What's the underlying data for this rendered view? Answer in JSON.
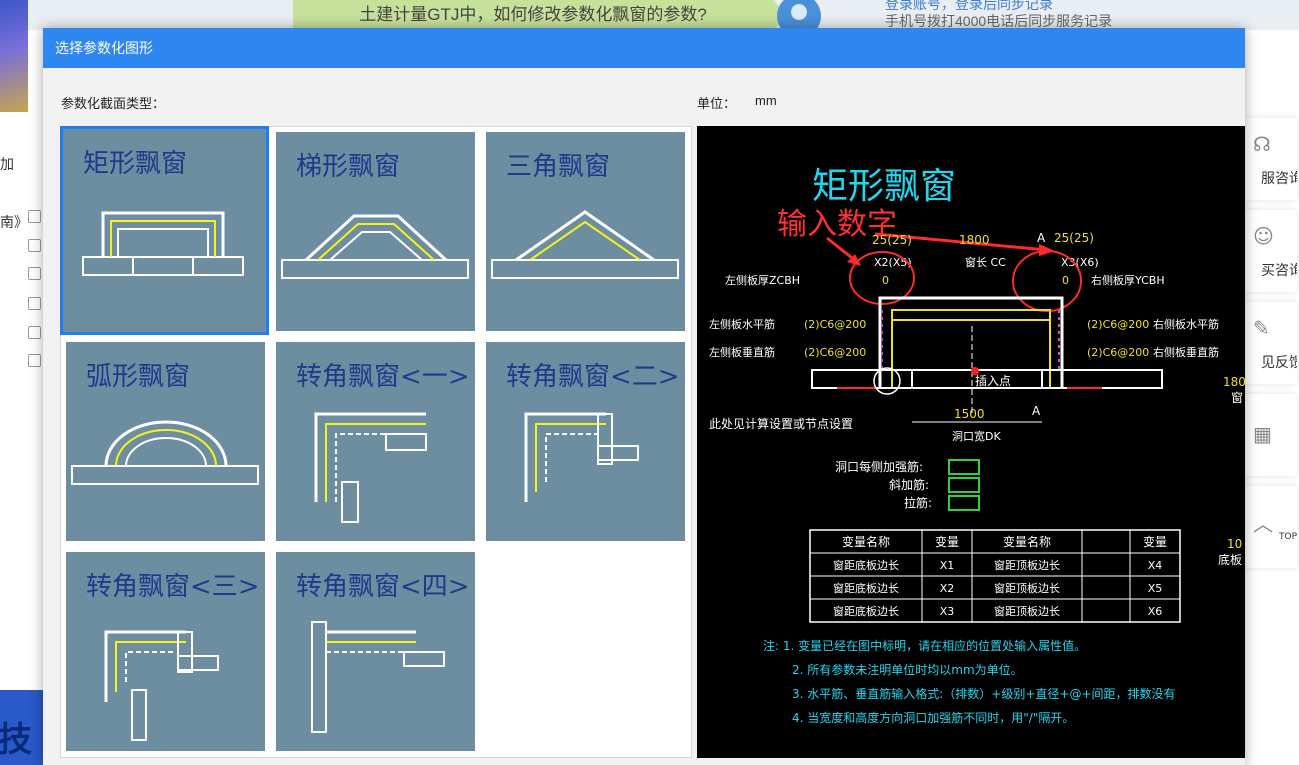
{
  "background_page": {
    "banner_question": "土建计量GTJ中，如何修改参数化飘窗的参数?",
    "note_line1": "登录账号，登录后同步记录",
    "note_line2": "手机号拨打4000电话后同步服务记录",
    "left_label_add": "加",
    "left_label_guide": "南》",
    "bottom_text": "技",
    "right_sidebar": [
      {
        "label": "服咨询",
        "icon": "headset-icon"
      },
      {
        "label": "买咨询",
        "icon": "service-icon"
      },
      {
        "label": "见反馈",
        "icon": "edit-icon"
      },
      {
        "label": "",
        "icon": "qrcode-icon"
      },
      {
        "label": "TOP",
        "icon": "up-arrow-icon"
      }
    ]
  },
  "dialog": {
    "title": "选择参数化图形",
    "section_label": "参数化截面类型：",
    "unit_label": "单位：",
    "unit_value": "mm",
    "shapes": [
      {
        "label": "矩形飘窗",
        "selected": true
      },
      {
        "label": "梯形飘窗",
        "selected": false
      },
      {
        "label": "三角飘窗",
        "selected": false
      },
      {
        "label": "弧形飘窗",
        "selected": false
      },
      {
        "label": "转角飘窗<一>",
        "selected": false
      },
      {
        "label": "转角飘窗<二>",
        "selected": false
      },
      {
        "label": "转角飘窗<三>",
        "selected": false
      },
      {
        "label": "转角飘窗<四>",
        "selected": false
      }
    ]
  },
  "preview": {
    "title": "矩形飘窗",
    "annotation": "输入数字",
    "top_left_dim": "25(25)",
    "top_mid_dim": "1800",
    "top_right_dim": "25(25)",
    "section_mark": "A",
    "x2_label": "X2(X5)",
    "window_length": "窗长 CC",
    "x3_label": "X3(X6)",
    "left_thick_label": "左侧板厚ZCBH",
    "left_thick_value": "0",
    "right_thick_value": "0",
    "right_thick_label": "右侧板厚YCBH",
    "left_h_rebar": "左侧板水平筋",
    "left_h_rebar_value": "(2)C6@200",
    "right_h_rebar_value": "(2)C6@200",
    "right_h_rebar": "右侧板水平筋",
    "left_v_rebar": "左侧板垂直筋",
    "left_v_rebar_value": "(2)C6@200",
    "right_v_rebar_value": "(2)C6@200",
    "right_v_rebar": "右侧板垂直筋",
    "insert_point": "插入点",
    "opening_width_value": "1500",
    "opening_width_label": "洞口宽DK",
    "calc_note": "此处见计算设置或节点设置",
    "edge_num_1": "180",
    "edge_char_1": "窗",
    "edge_num_2": "10",
    "edge_char_2": "底板",
    "rebar_opening": "洞口每侧加强筋:",
    "rebar_diag": "斜加筋:",
    "rebar_tie": "拉筋:",
    "table_header": [
      "变量名称",
      "变量",
      "变量名称",
      "变量"
    ],
    "table_rows": [
      [
        "窗距底板边长",
        "X1",
        "窗距顶板边长",
        "X4"
      ],
      [
        "窗距底板边长",
        "X2",
        "窗距顶板边长",
        "X5"
      ],
      [
        "窗距底板边长",
        "X3",
        "窗距顶板边长",
        "X6"
      ]
    ],
    "notes": [
      "注: 1. 变量已经在图中标明，请在相应的位置处输入属性值。",
      "2. 所有参数未注明单位时均以mm为单位。",
      "3. 水平筋、垂直筋输入格式:（排数）+级别+直径+@+间距，排数没有",
      "4. 当宽度和高度方向洞口加强筋不同时，用\"/\"隔开。"
    ]
  }
}
